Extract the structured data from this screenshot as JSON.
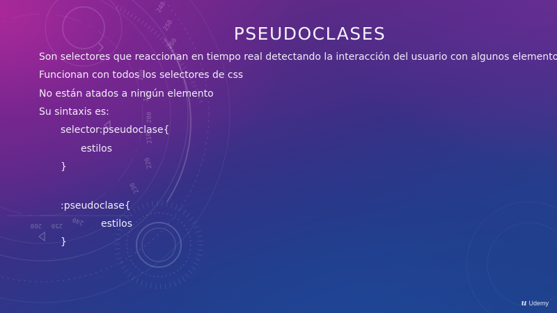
{
  "slide": {
    "title": "PSEUDOCLASES",
    "lines": [
      "Son selectores que reaccionan en tiempo real detectando la interacción del usuario con algunos elementos",
      "Funcionan con todos los selectores de css",
      "No están atados a ningún elemento",
      "Su sintaxis es:"
    ],
    "code1": {
      "open": "selector:pseudoclase{",
      "body": "estilos",
      "close": "}"
    },
    "code2": {
      "open": ":pseudoclase{",
      "body": "estilos",
      "close": "}"
    }
  },
  "decor_dial_numbers": [
    "260",
    "250",
    "240",
    "230",
    "220",
    "210",
    "200",
    "190",
    "180",
    "240",
    "250",
    "260",
    "220"
  ],
  "watermark": {
    "logo": "u",
    "text": "Udemy"
  },
  "colors": {
    "text": "#f1ecf7",
    "background_top_left": "#b2289b",
    "background_bottom_right": "#1f468f"
  }
}
